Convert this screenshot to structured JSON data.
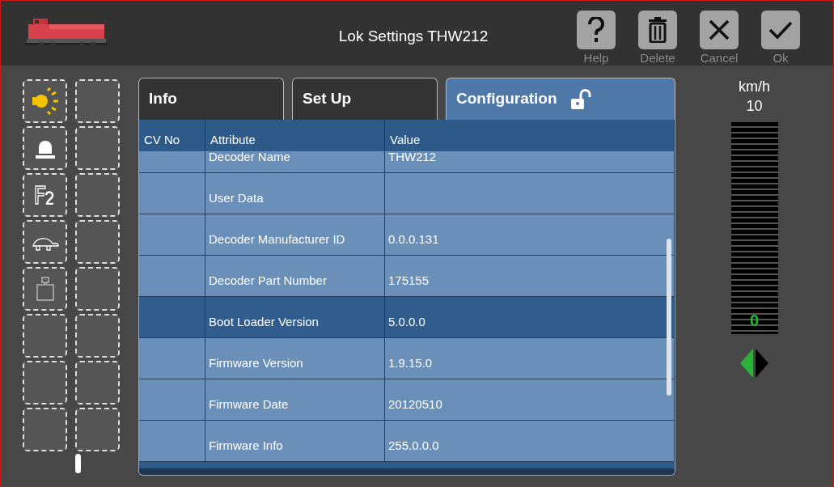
{
  "window": {
    "title": "Lok Settings THW212"
  },
  "toolbar": [
    {
      "kind": "help",
      "label": "Help"
    },
    {
      "kind": "delete",
      "label": "Delete"
    },
    {
      "kind": "cancel",
      "label": "Cancel"
    },
    {
      "kind": "ok",
      "label": "Ok"
    }
  ],
  "function_keys": [
    {
      "kind": "light"
    },
    {
      "kind": "empty"
    },
    {
      "kind": "beacon"
    },
    {
      "kind": "empty"
    },
    {
      "kind": "f2"
    },
    {
      "kind": "empty"
    },
    {
      "kind": "turtle"
    },
    {
      "kind": "empty"
    },
    {
      "kind": "weight"
    },
    {
      "kind": "empty"
    },
    {
      "kind": "empty"
    },
    {
      "kind": "empty"
    },
    {
      "kind": "empty"
    },
    {
      "kind": "empty"
    },
    {
      "kind": "empty"
    },
    {
      "kind": "empty"
    }
  ],
  "tabs": [
    {
      "label": "Info",
      "selected": false
    },
    {
      "label": "Set Up",
      "selected": false
    },
    {
      "label": "Configuration",
      "selected": true,
      "locked": false
    }
  ],
  "table": {
    "columns": [
      "CV No",
      "Attribute",
      "Value"
    ],
    "rows": [
      {
        "attribute": "Decoder Name",
        "value": "THW212",
        "selected": false
      },
      {
        "attribute": "User Data",
        "selected": false
      },
      {
        "attribute": "Decoder Manufacturer ID",
        "value": "0.0.0.131",
        "selected": false
      },
      {
        "attribute": "Decoder Part Number",
        "value": "175155",
        "selected": false
      },
      {
        "attribute": "Boot Loader Version",
        "value": "5.0.0.0",
        "selected": true
      },
      {
        "attribute": "Firmware Version",
        "value": "1.9.15.0",
        "selected": false
      },
      {
        "attribute": "Firmware Date",
        "value": "20120510",
        "selected": false
      },
      {
        "attribute": "Firmware Info",
        "value": "255.0.0.0",
        "selected": false
      }
    ]
  },
  "speed": {
    "unit": "km/h",
    "max": "10",
    "reading": "0",
    "direction": [
      {
        "kind": "reverse",
        "selected": true
      },
      {
        "kind": "forward",
        "selected": false
      }
    ]
  }
}
